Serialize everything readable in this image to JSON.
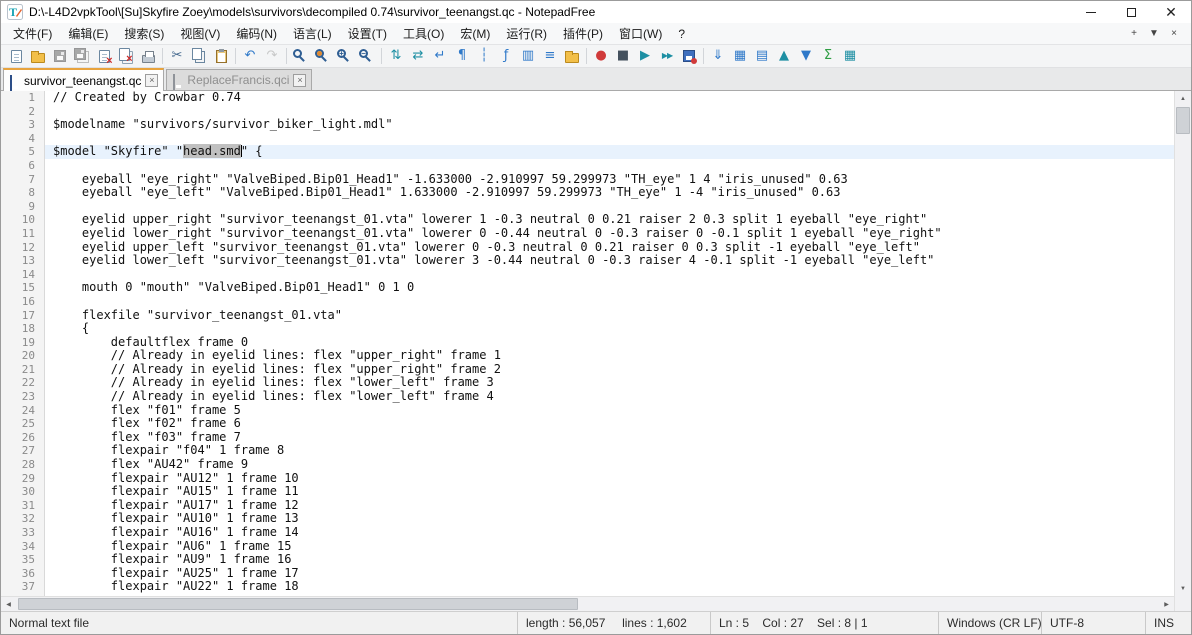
{
  "window": {
    "title": "D:\\-L4D2vpkTool\\[Su]Skyfire Zoey\\models\\survivors\\decompiled 0.74\\survivor_teenangst.qc - NotepadFree"
  },
  "menubar": {
    "items": [
      {
        "key": "file",
        "label": "文件(F)"
      },
      {
        "key": "edit",
        "label": "编辑(E)"
      },
      {
        "key": "search",
        "label": "搜索(S)"
      },
      {
        "key": "view",
        "label": "视图(V)"
      },
      {
        "key": "encoding",
        "label": "编码(N)"
      },
      {
        "key": "language",
        "label": "语言(L)"
      },
      {
        "key": "settings",
        "label": "设置(T)"
      },
      {
        "key": "tools",
        "label": "工具(O)"
      },
      {
        "key": "macro",
        "label": "宏(M)"
      },
      {
        "key": "run",
        "label": "运行(R)"
      },
      {
        "key": "plugins",
        "label": "插件(P)"
      },
      {
        "key": "window",
        "label": "窗口(W)"
      },
      {
        "key": "help",
        "label": "?"
      }
    ],
    "right_controls": [
      {
        "name": "new-tab-button",
        "icon_name": "plus-icon",
        "glyph": "+"
      },
      {
        "name": "tab-list-button",
        "icon_name": "chevron-down-icon",
        "glyph": "▼"
      },
      {
        "name": "close-tab-button",
        "icon_name": "close-icon",
        "glyph": "×"
      }
    ]
  },
  "toolbar": {
    "items": [
      {
        "name": "new-file-icon",
        "shape": "doc"
      },
      {
        "name": "open-file-icon",
        "shape": "folder"
      },
      {
        "name": "save-icon",
        "shape": "floppy",
        "disabled": true
      },
      {
        "name": "save-all-icon",
        "shape": "floppy-all",
        "disabled": true
      },
      {
        "name": "close-doc-icon",
        "shape": "doc-close"
      },
      {
        "name": "close-all-docs-icon",
        "shape": "doc-close-all"
      },
      {
        "name": "print-icon",
        "shape": "printer"
      },
      {
        "sep": true
      },
      {
        "name": "cut-icon",
        "glyph": "✂",
        "color": "#41668c"
      },
      {
        "name": "copy-icon",
        "shape": "copy"
      },
      {
        "name": "paste-icon",
        "shape": "clipboard"
      },
      {
        "sep": true
      },
      {
        "name": "undo-icon",
        "glyph": "↶",
        "color": "#2f79c9"
      },
      {
        "name": "redo-icon",
        "glyph": "↷",
        "color": "#9aa5b1",
        "disabled": true
      },
      {
        "sep": true
      },
      {
        "name": "find-icon",
        "shape": "find"
      },
      {
        "name": "replace-icon",
        "shape": "replace"
      },
      {
        "name": "zoom-in-icon",
        "shape": "zoom-in"
      },
      {
        "name": "zoom-out-icon",
        "shape": "zoom-out"
      },
      {
        "sep": true
      },
      {
        "name": "sync-vertical-scroll-icon",
        "glyph": "⇅",
        "color": "#1d8fa3"
      },
      {
        "name": "sync-horizontal-scroll-icon",
        "glyph": "⇄",
        "color": "#1d8fa3"
      },
      {
        "name": "word-wrap-icon",
        "glyph": "↵",
        "color": "#2f79c9"
      },
      {
        "name": "show-all-chars-icon",
        "glyph": "¶",
        "color": "#2f79c9"
      },
      {
        "name": "indent-guide-icon",
        "glyph": "┆",
        "color": "#2f79c9"
      },
      {
        "name": "function-list-icon",
        "glyph": "ƒ",
        "color": "#2f79c9"
      },
      {
        "name": "doc-map-icon",
        "glyph": "▥",
        "color": "#2f79c9"
      },
      {
        "name": "doc-list-icon",
        "glyph": "≡",
        "color": "#2f79c9"
      },
      {
        "name": "folder-workspace-icon",
        "shape": "folder"
      },
      {
        "sep": true
      },
      {
        "name": "record-macro-icon",
        "glyph": "●",
        "color": "#d03a3a"
      },
      {
        "name": "stop-macro-icon",
        "glyph": "■",
        "color": "#44515e"
      },
      {
        "name": "play-macro-icon",
        "glyph": "▶",
        "color": "#1d8fa3"
      },
      {
        "name": "run-macro-multiple-icon",
        "glyph": "▶▶",
        "color": "#1d8fa3",
        "small": true
      },
      {
        "name": "save-macro-icon",
        "shape": "floppy-rec"
      },
      {
        "sep": true
      },
      {
        "name": "export-doc-icon",
        "glyph": "⇓",
        "color": "#2f79c9"
      },
      {
        "name": "table-grid-icon",
        "glyph": "▦",
        "color": "#2f79c9"
      },
      {
        "name": "table-sheet-icon",
        "glyph": "▤",
        "color": "#2f79c9"
      },
      {
        "name": "sort-ascending-icon",
        "glyph": "▲",
        "color": "#1d8fa3"
      },
      {
        "name": "sort-descending-icon",
        "glyph": "▼",
        "color": "#2f79c9"
      },
      {
        "name": "sum-icon",
        "glyph": "Σ",
        "color": "#2f9e44"
      },
      {
        "name": "export-grid-icon",
        "glyph": "▦",
        "color": "#1d8fa3"
      }
    ]
  },
  "tabbar": {
    "tabs": [
      {
        "name": "tab-survivor-teenangst-qc",
        "label": "survivor_teenangst.qc",
        "active": true
      },
      {
        "name": "tab-replacefrancis-qci",
        "label": "ReplaceFrancis.qci",
        "active": false
      }
    ]
  },
  "editor": {
    "current_line": 5,
    "selection": {
      "line": 5,
      "text": "head.smd"
    },
    "lines": [
      "// Created by Crowbar 0.74",
      "",
      "$modelname \"survivors/survivor_biker_light.mdl\"",
      "",
      "$model \"Skyfire\" \"head.smd\" {",
      "",
      "    eyeball \"eye_right\" \"ValveBiped.Bip01_Head1\" -1.633000 -2.910997 59.299973 \"TH_eye\" 1 4 \"iris_unused\" 0.63",
      "    eyeball \"eye_left\" \"ValveBiped.Bip01_Head1\" 1.633000 -2.910997 59.299973 \"TH_eye\" 1 -4 \"iris_unused\" 0.63",
      "",
      "    eyelid upper_right \"survivor_teenangst_01.vta\" lowerer 1 -0.3 neutral 0 0.21 raiser 2 0.3 split 1 eyeball \"eye_right\"",
      "    eyelid lower_right \"survivor_teenangst_01.vta\" lowerer 0 -0.44 neutral 0 -0.3 raiser 0 -0.1 split 1 eyeball \"eye_right\"",
      "    eyelid upper_left \"survivor_teenangst_01.vta\" lowerer 0 -0.3 neutral 0 0.21 raiser 0 0.3 split -1 eyeball \"eye_left\"",
      "    eyelid lower_left \"survivor_teenangst_01.vta\" lowerer 3 -0.44 neutral 0 -0.3 raiser 4 -0.1 split -1 eyeball \"eye_left\"",
      "",
      "    mouth 0 \"mouth\" \"ValveBiped.Bip01_Head1\" 0 1 0",
      "",
      "    flexfile \"survivor_teenangst_01.vta\"",
      "    {",
      "        defaultflex frame 0",
      "        // Already in eyelid lines: flex \"upper_right\" frame 1",
      "        // Already in eyelid lines: flex \"upper_right\" frame 2",
      "        // Already in eyelid lines: flex \"lower_left\" frame 3",
      "        // Already in eyelid lines: flex \"lower_left\" frame 4",
      "        flex \"f01\" frame 5",
      "        flex \"f02\" frame 6",
      "        flex \"f03\" frame 7",
      "        flexpair \"f04\" 1 frame 8",
      "        flex \"AU42\" frame 9",
      "        flexpair \"AU12\" 1 frame 10",
      "        flexpair \"AU15\" 1 frame 11",
      "        flexpair \"AU17\" 1 frame 12",
      "        flexpair \"AU10\" 1 frame 13",
      "        flexpair \"AU16\" 1 frame 14",
      "        flexpair \"AU6\" 1 frame 15",
      "        flexpair \"AU9\" 1 frame 16",
      "        flexpair \"AU25\" 1 frame 17",
      "        flexpair \"AU22\" 1 frame 18"
    ]
  },
  "statusbar": {
    "doc_type": "Normal text file",
    "length_info": "length : 56,057     lines : 1,602",
    "cursor_info": "Ln : 5    Col : 27    Sel : 8 | 1",
    "eol": "Windows (CR LF)",
    "encoding": "UTF-8",
    "insert_mode": "INS"
  },
  "colors": {
    "selection": "#c0c0c0",
    "current_line": "#e8f2fd",
    "active_tab_accent": "#e8a33d"
  }
}
